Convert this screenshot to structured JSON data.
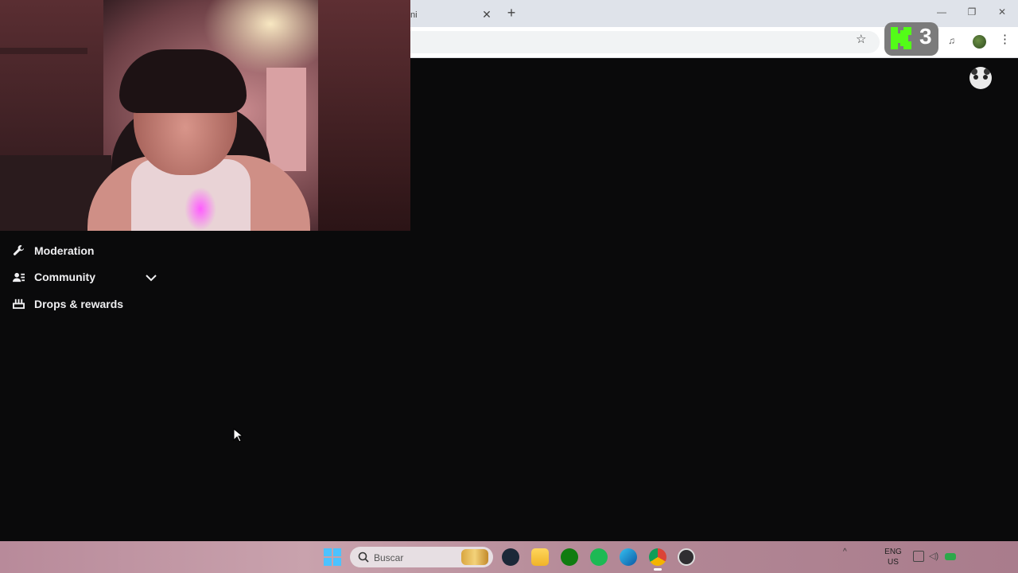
{
  "browser": {
    "tab": {
      "title": "ni",
      "close_symbol": "✕"
    },
    "new_tab_symbol": "+",
    "window": {
      "minimize": "—",
      "restore": "❐",
      "close": "✕"
    },
    "toolbar": {
      "bookmark_symbol": "☆",
      "menu_symbol": "⋮"
    },
    "extensions": {
      "kick_number": "3",
      "kick_color": "#53fc18"
    }
  },
  "sidebar": {
    "items": [
      {
        "label": "Moderation",
        "icon": "wrench-icon"
      },
      {
        "label": "Community",
        "icon": "community-icon",
        "expandable": true
      },
      {
        "label": "Drops & rewards",
        "icon": "drops-icon"
      }
    ]
  },
  "taskbar": {
    "search_placeholder": "Buscar",
    "apps": [
      "windows-start-icon",
      "steam-icon",
      "file-explorer-icon",
      "xbox-icon",
      "spotify-icon",
      "edge-icon",
      "chrome-icon",
      "obs-icon"
    ],
    "language": {
      "line1": "ENG",
      "line2": "US"
    }
  },
  "colors": {
    "page_background": "#0a0a0b",
    "sidebar_text": "#efeff1",
    "tabstrip": "#dfe3ea",
    "kick_green": "#53fc18"
  }
}
